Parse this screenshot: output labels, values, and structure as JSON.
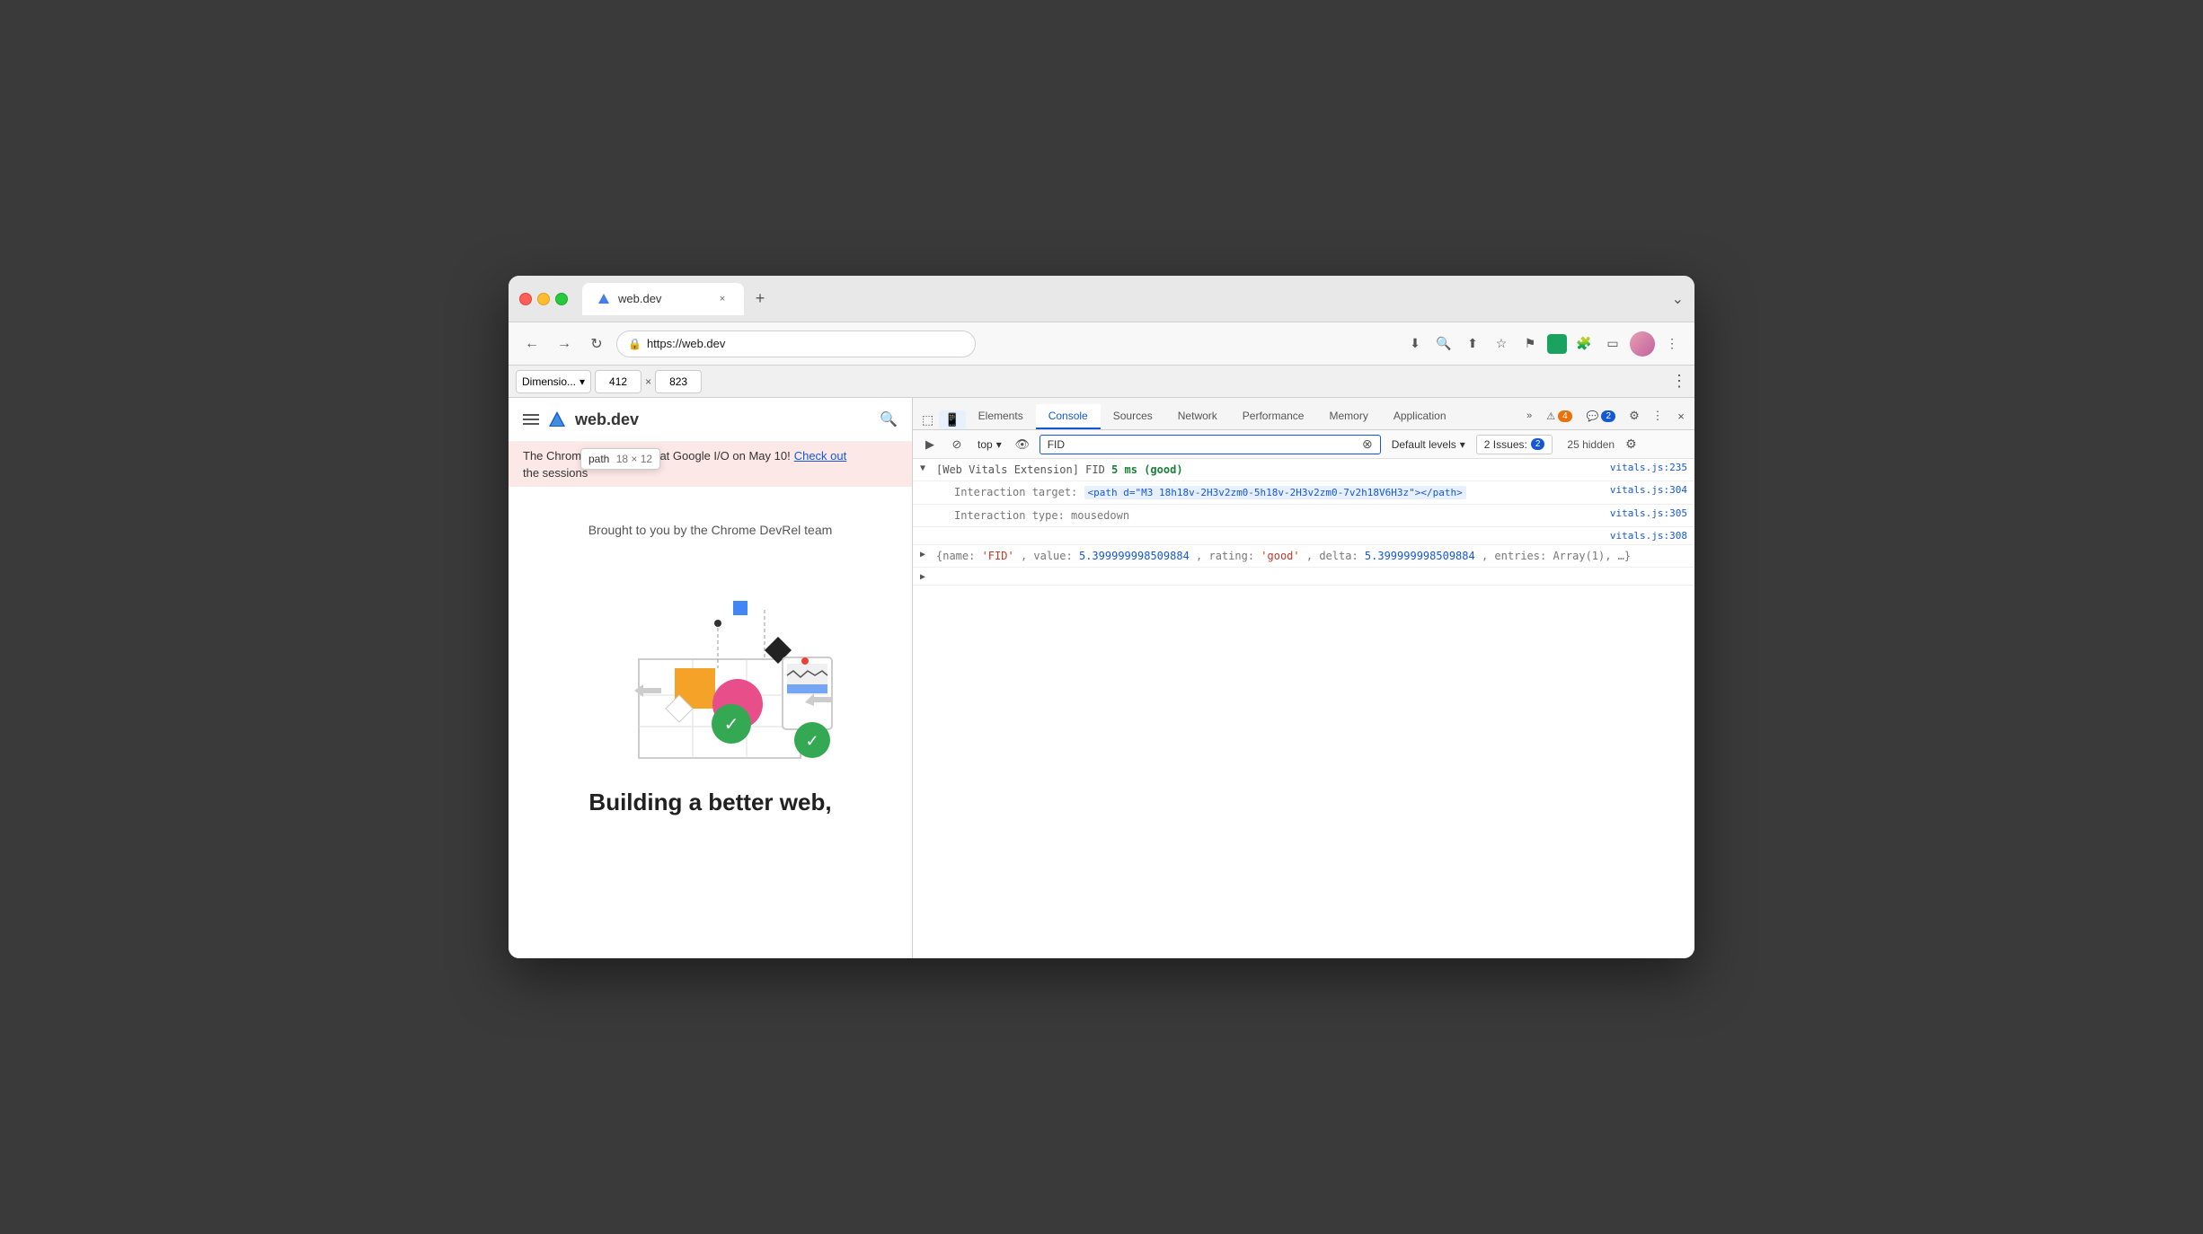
{
  "browser": {
    "tab": {
      "favicon": "🌐",
      "title": "web.dev",
      "close_label": "×"
    },
    "new_tab_label": "+",
    "chevron_label": "⌄"
  },
  "address_bar": {
    "back_label": "←",
    "forward_label": "→",
    "reload_label": "↻",
    "lock_icon": "🔒",
    "url": "https://web.dev",
    "download_icon": "⬇",
    "zoom_icon": "🔍",
    "share_icon": "⬆",
    "star_icon": "☆",
    "flag_icon": "⚑",
    "extensions_icon": "🧩",
    "sidebar_icon": "▭",
    "more_icon": "⋮"
  },
  "devtools_bar": {
    "dimension_label": "Dimensio...",
    "width": "412",
    "separator": "×",
    "height": "823",
    "more_icon": "⋮"
  },
  "webpage": {
    "logo_text": "web.dev",
    "search_icon": "🔍",
    "tooltip": {
      "label": "path",
      "size": "18 × 12"
    },
    "banner_text": "The Chrome team is back at Google I/O on May 10! Check out",
    "banner_link_text": "Check out",
    "banner_suffix": "the sessions",
    "brought_by": "Brought to you by the Chrome DevRel team",
    "building_text": "Building a better web,"
  },
  "devtools": {
    "tabs": [
      {
        "label": "Elements",
        "active": false
      },
      {
        "label": "Console",
        "active": true
      },
      {
        "label": "Sources",
        "active": false
      },
      {
        "label": "Network",
        "active": false
      },
      {
        "label": "Performance",
        "active": false
      },
      {
        "label": "Memory",
        "active": false
      },
      {
        "label": "Application",
        "active": false
      }
    ],
    "more_tabs_label": "»",
    "warn_count": "4",
    "info_count": "2",
    "settings_icon": "⚙",
    "more_icon": "⋮",
    "close_icon": "×",
    "console_toolbar": {
      "run_icon": "▶",
      "stop_icon": "⊘",
      "context": "top",
      "context_dropdown": "▾",
      "eye_icon": "👁",
      "filter_value": "FID",
      "filter_clear": "⊗",
      "default_levels": "Default levels",
      "default_levels_dropdown": "▾",
      "issues_label": "2 Issues:",
      "issues_badge": "2",
      "hidden_count": "25 hidden",
      "settings_icon": "⚙"
    },
    "console_entries": [
      {
        "id": 1,
        "expanded": true,
        "indent": 0,
        "parts": [
          {
            "text": "[Web Vitals Extension] FID ",
            "class": "c-gray"
          },
          {
            "text": "5 ms (good)",
            "class": "fid-ms"
          }
        ],
        "source": "vitals.js:235"
      },
      {
        "id": 2,
        "expanded": false,
        "indent": 1,
        "parts": [
          {
            "text": "Interaction target:  ",
            "class": "c-gray"
          },
          {
            "text": "<path d=\"M3 18h18v-2H3v2zm0-5h18v-2H3v2zm0-7v2h18V6H3z\"></path>",
            "class": "highlight-blue"
          }
        ],
        "source": "vitals.js:304"
      },
      {
        "id": 3,
        "expanded": false,
        "indent": 1,
        "parts": [
          {
            "text": "Interaction type: mousedown",
            "class": "c-gray"
          }
        ],
        "source": "vitals.js:305"
      },
      {
        "id": 4,
        "expanded": false,
        "indent": 1,
        "parts": [],
        "source": "vitals.js:308"
      },
      {
        "id": 5,
        "expanded": false,
        "indent": 0,
        "parts": [
          {
            "text": "▶ {name: ",
            "class": "c-gray"
          },
          {
            "text": "'FID'",
            "class": "c-red"
          },
          {
            "text": ", value: ",
            "class": "c-gray"
          },
          {
            "text": "5.399999998509884",
            "class": "c-blue"
          },
          {
            "text": ", rating: ",
            "class": "c-gray"
          },
          {
            "text": "'good'",
            "class": "c-red"
          },
          {
            "text": ", delta: ",
            "class": "c-gray"
          },
          {
            "text": "5.399999998509884",
            "class": "c-blue"
          },
          {
            "text": ", entries: Array(1), …}",
            "class": "c-gray"
          }
        ],
        "source": ""
      }
    ],
    "input_prompt": ">"
  }
}
